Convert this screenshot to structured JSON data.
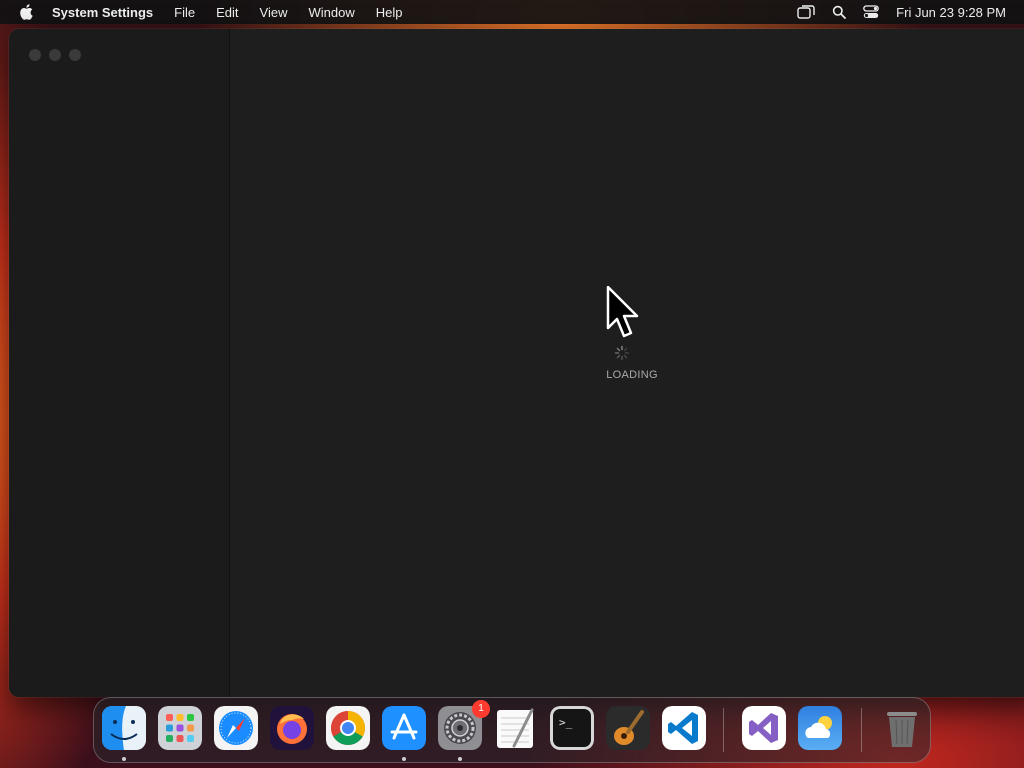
{
  "menubar": {
    "apple_icon": "apple-icon",
    "app_name": "System Settings",
    "menus": [
      "File",
      "Edit",
      "View",
      "Window",
      "Help"
    ],
    "status_icons": [
      "screen-mirroring-icon",
      "search-icon",
      "control-center-icon"
    ],
    "clock": "Fri Jun 23  9:28 PM"
  },
  "window": {
    "traffic_lights": [
      "close",
      "minimize",
      "zoom"
    ],
    "loading_text": "LOADING"
  },
  "dock": {
    "items": [
      {
        "name": "Finder",
        "icon": "finder-icon",
        "running": true
      },
      {
        "name": "Launchpad",
        "icon": "launchpad-icon",
        "running": false
      },
      {
        "name": "Safari",
        "icon": "safari-icon",
        "running": false
      },
      {
        "name": "Firefox",
        "icon": "firefox-icon",
        "running": false
      },
      {
        "name": "Chrome",
        "icon": "chrome-icon",
        "running": false
      },
      {
        "name": "App Store",
        "icon": "app-store-icon",
        "running": true
      },
      {
        "name": "System Settings",
        "icon": "system-settings-icon",
        "running": true,
        "badge": "1"
      },
      {
        "name": "TextEdit",
        "icon": "textedit-icon",
        "running": false
      },
      {
        "name": "Terminal",
        "icon": "terminal-icon",
        "running": false
      },
      {
        "name": "GarageBand",
        "icon": "garageband-icon",
        "running": false
      },
      {
        "name": "Visual Studio Code",
        "icon": "vscode-icon",
        "running": false
      },
      {
        "name": "Visual Studio",
        "icon": "visual-studio-icon",
        "running": false
      },
      {
        "name": "Weather",
        "icon": "weather-icon",
        "running": false
      },
      {
        "name": "Trash",
        "icon": "trash-icon",
        "running": false
      }
    ]
  }
}
